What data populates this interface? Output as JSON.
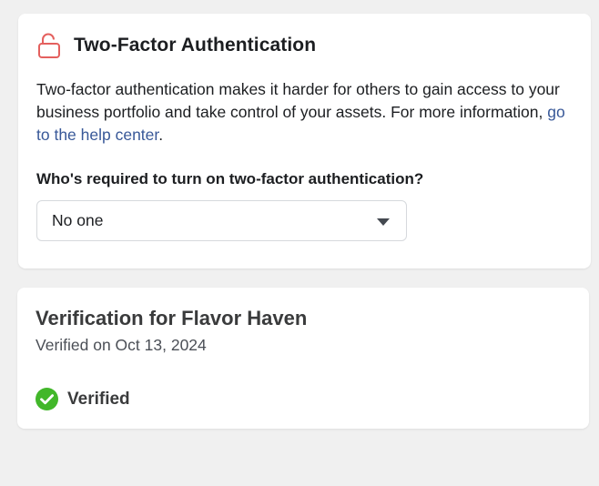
{
  "two_factor": {
    "title": "Two-Factor Authentication",
    "description_text": "Two-factor authentication makes it harder for others to gain access to your business portfolio and take control of your assets. For more information, ",
    "help_link": "go to the help center",
    "description_end": ".",
    "question": "Who's required to turn on two-factor authentication?",
    "select_value": "No one",
    "lock_icon": "unlocked-padlock-icon",
    "accent_color": "#e4605e"
  },
  "verification": {
    "title": "Verification for Flavor Haven",
    "date": "Verified on Oct 13, 2024",
    "status": "Verified",
    "status_icon": "check-circle-icon",
    "status_color": "#42b72a"
  }
}
